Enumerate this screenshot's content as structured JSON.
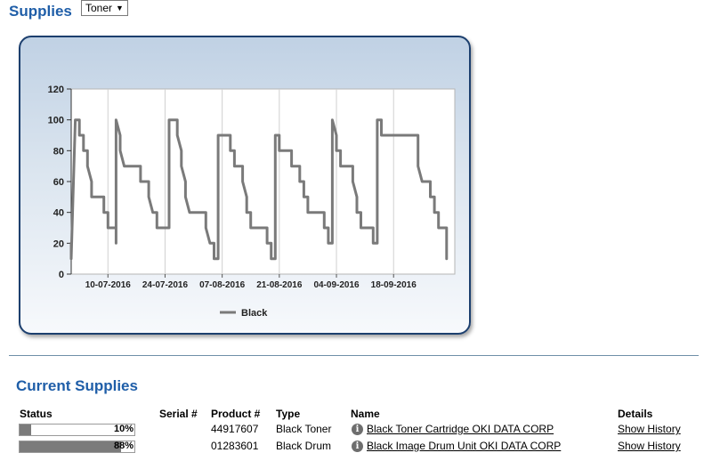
{
  "header": {
    "title": "Supplies",
    "type_select": {
      "value": "Toner",
      "arrow": "▼"
    }
  },
  "chart_data": {
    "type": "line",
    "title": "",
    "xlabel": "",
    "ylabel": "",
    "ylim": [
      0,
      120
    ],
    "yticks": [
      0,
      20,
      40,
      60,
      80,
      100,
      120
    ],
    "xlim": [
      "2016-07-01",
      "2016-10-03"
    ],
    "xticks": [
      "10-07-2016",
      "24-07-2016",
      "07-08-2016",
      "21-08-2016",
      "04-09-2016",
      "18-09-2016"
    ],
    "legend": {
      "position": "bottom-center",
      "entries": [
        "Black"
      ]
    },
    "grid": {
      "vertical": true,
      "horizontal": false
    },
    "color": "#7a7a7a",
    "series": [
      {
        "name": "Black",
        "points": [
          [
            "2016-07-01",
            20
          ],
          [
            "2016-07-01",
            10
          ],
          [
            "2016-07-02",
            100
          ],
          [
            "2016-07-03",
            100
          ],
          [
            "2016-07-03",
            90
          ],
          [
            "2016-07-04",
            90
          ],
          [
            "2016-07-04",
            80
          ],
          [
            "2016-07-05",
            80
          ],
          [
            "2016-07-05",
            70
          ],
          [
            "2016-07-06",
            60
          ],
          [
            "2016-07-06",
            50
          ],
          [
            "2016-07-09",
            50
          ],
          [
            "2016-07-09",
            40
          ],
          [
            "2016-07-10",
            40
          ],
          [
            "2016-07-10",
            30
          ],
          [
            "2016-07-12",
            30
          ],
          [
            "2016-07-12",
            20
          ],
          [
            "2016-07-12",
            100
          ],
          [
            "2016-07-13",
            90
          ],
          [
            "2016-07-13",
            80
          ],
          [
            "2016-07-14",
            70
          ],
          [
            "2016-07-18",
            70
          ],
          [
            "2016-07-18",
            60
          ],
          [
            "2016-07-20",
            60
          ],
          [
            "2016-07-20",
            50
          ],
          [
            "2016-07-21",
            40
          ],
          [
            "2016-07-22",
            40
          ],
          [
            "2016-07-22",
            30
          ],
          [
            "2016-07-25",
            30
          ],
          [
            "2016-07-25",
            100
          ],
          [
            "2016-07-27",
            100
          ],
          [
            "2016-07-27",
            90
          ],
          [
            "2016-07-28",
            80
          ],
          [
            "2016-07-28",
            70
          ],
          [
            "2016-07-29",
            60
          ],
          [
            "2016-07-29",
            50
          ],
          [
            "2016-07-30",
            40
          ],
          [
            "2016-08-03",
            40
          ],
          [
            "2016-08-03",
            30
          ],
          [
            "2016-08-04",
            20
          ],
          [
            "2016-08-05",
            20
          ],
          [
            "2016-08-05",
            10
          ],
          [
            "2016-08-06",
            10
          ],
          [
            "2016-08-06",
            90
          ],
          [
            "2016-08-09",
            90
          ],
          [
            "2016-08-09",
            80
          ],
          [
            "2016-08-10",
            80
          ],
          [
            "2016-08-10",
            70
          ],
          [
            "2016-08-12",
            70
          ],
          [
            "2016-08-12",
            60
          ],
          [
            "2016-08-13",
            50
          ],
          [
            "2016-08-13",
            40
          ],
          [
            "2016-08-14",
            40
          ],
          [
            "2016-08-14",
            30
          ],
          [
            "2016-08-18",
            30
          ],
          [
            "2016-08-18",
            20
          ],
          [
            "2016-08-19",
            20
          ],
          [
            "2016-08-19",
            10
          ],
          [
            "2016-08-20",
            10
          ],
          [
            "2016-08-20",
            90
          ],
          [
            "2016-08-21",
            90
          ],
          [
            "2016-08-21",
            80
          ],
          [
            "2016-08-24",
            80
          ],
          [
            "2016-08-24",
            70
          ],
          [
            "2016-08-26",
            70
          ],
          [
            "2016-08-26",
            60
          ],
          [
            "2016-08-27",
            60
          ],
          [
            "2016-08-27",
            50
          ],
          [
            "2016-08-28",
            50
          ],
          [
            "2016-08-28",
            40
          ],
          [
            "2016-09-01",
            40
          ],
          [
            "2016-09-01",
            30
          ],
          [
            "2016-09-02",
            30
          ],
          [
            "2016-09-02",
            20
          ],
          [
            "2016-09-03",
            20
          ],
          [
            "2016-09-03",
            100
          ],
          [
            "2016-09-04",
            90
          ],
          [
            "2016-09-04",
            80
          ],
          [
            "2016-09-05",
            80
          ],
          [
            "2016-09-05",
            70
          ],
          [
            "2016-09-08",
            70
          ],
          [
            "2016-09-08",
            60
          ],
          [
            "2016-09-09",
            50
          ],
          [
            "2016-09-09",
            40
          ],
          [
            "2016-09-10",
            40
          ],
          [
            "2016-09-10",
            30
          ],
          [
            "2016-09-13",
            30
          ],
          [
            "2016-09-13",
            20
          ],
          [
            "2016-09-14",
            20
          ],
          [
            "2016-09-14",
            100
          ],
          [
            "2016-09-15",
            100
          ],
          [
            "2016-09-15",
            90
          ],
          [
            "2016-09-24",
            90
          ],
          [
            "2016-09-24",
            70
          ],
          [
            "2016-09-25",
            60
          ],
          [
            "2016-09-27",
            60
          ],
          [
            "2016-09-27",
            50
          ],
          [
            "2016-09-28",
            50
          ],
          [
            "2016-09-28",
            40
          ],
          [
            "2016-09-29",
            40
          ],
          [
            "2016-09-29",
            30
          ],
          [
            "2016-10-01",
            30
          ],
          [
            "2016-10-01",
            10
          ]
        ]
      }
    ]
  },
  "current": {
    "title": "Current Supplies",
    "headers": {
      "status": "Status",
      "serial": "Serial #",
      "product": "Product #",
      "type": "Type",
      "name": "Name",
      "details": "Details"
    },
    "rows": [
      {
        "status_pct": 10,
        "status_label": "10%",
        "serial": "",
        "product": "44917607",
        "type": "Black Toner",
        "name": "Black Toner Cartridge OKI DATA CORP",
        "details": "Show History",
        "info_icon": "info-icon"
      },
      {
        "status_pct": 88,
        "status_label": "88%",
        "serial": "",
        "product": "01283601",
        "type": "Black Drum",
        "name": "Black Image Drum Unit OKI DATA CORP",
        "details": "Show History",
        "info_icon": "info-icon"
      }
    ]
  }
}
